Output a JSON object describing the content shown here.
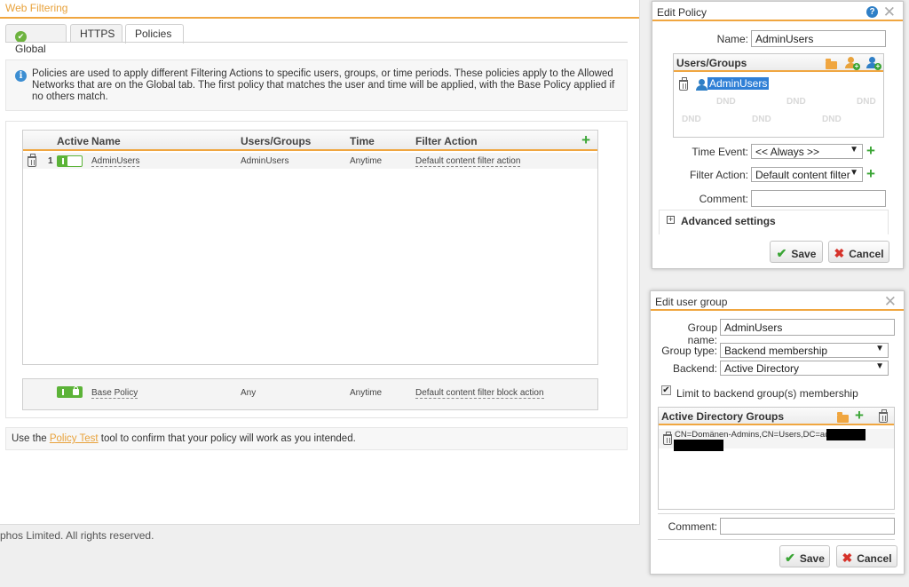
{
  "main": {
    "title": "Web Filtering",
    "tabs": [
      {
        "label": "Global"
      },
      {
        "label": "HTTPS"
      },
      {
        "label": "Policies"
      }
    ],
    "info_text": "Policies are used to apply different Filtering Actions to specific users, groups, or time periods. These policies apply to the Allowed Networks that are on the Global tab. The first policy that matches the user and time will be applied, with the Base Policy applied if no others match.",
    "table": {
      "columns": {
        "active": "Active",
        "name": "Name",
        "users": "Users/Groups",
        "time": "Time",
        "action": "Filter Action"
      },
      "rows": [
        {
          "index": "1",
          "name": "AdminUsers",
          "users": "AdminUsers",
          "time": "Anytime",
          "action": "Default content filter action"
        }
      ]
    },
    "base_policy": {
      "name": "Base Policy",
      "users": "Any",
      "time": "Anytime",
      "action": "Default content filter block action"
    },
    "footer": {
      "prefix": "Use the ",
      "link": "Policy Test",
      "suffix": " tool to confirm that your policy will work as you intended."
    },
    "copyright": "phos Limited. All rights reserved."
  },
  "edit_policy": {
    "title": "Edit Policy",
    "name_label": "Name:",
    "name_value": "AdminUsers",
    "users_groups_header": "Users/Groups",
    "selected_user": "AdminUsers",
    "dnd_label": "DND",
    "time_event_label": "Time Event:",
    "time_event_value": "<< Always >>",
    "filter_action_label": "Filter Action:",
    "filter_action_value": "Default content filter",
    "comment_label": "Comment:",
    "comment_value": "",
    "advanced_label": "Advanced settings",
    "save_label": "Save",
    "cancel_label": "Cancel"
  },
  "edit_user_group": {
    "title": "Edit user group",
    "group_name_label": "Group name:",
    "group_name_value": "AdminUsers",
    "group_type_label": "Group type:",
    "group_type_value": "Backend membership",
    "backend_label": "Backend:",
    "backend_value": "Active Directory",
    "limit_label": "Limit to backend group(s) membership",
    "ad_groups_header": "Active Directory Groups",
    "ad_group_entry": "CN=Domänen-Admins,CN=Users,DC=ad",
    "comment_label": "Comment:",
    "comment_value": "",
    "save_label": "Save",
    "cancel_label": "Cancel"
  },
  "colors": {
    "accent": "#f0a640",
    "green": "#5cb338",
    "blue": "#2f7fd6",
    "red": "#d6322a"
  }
}
